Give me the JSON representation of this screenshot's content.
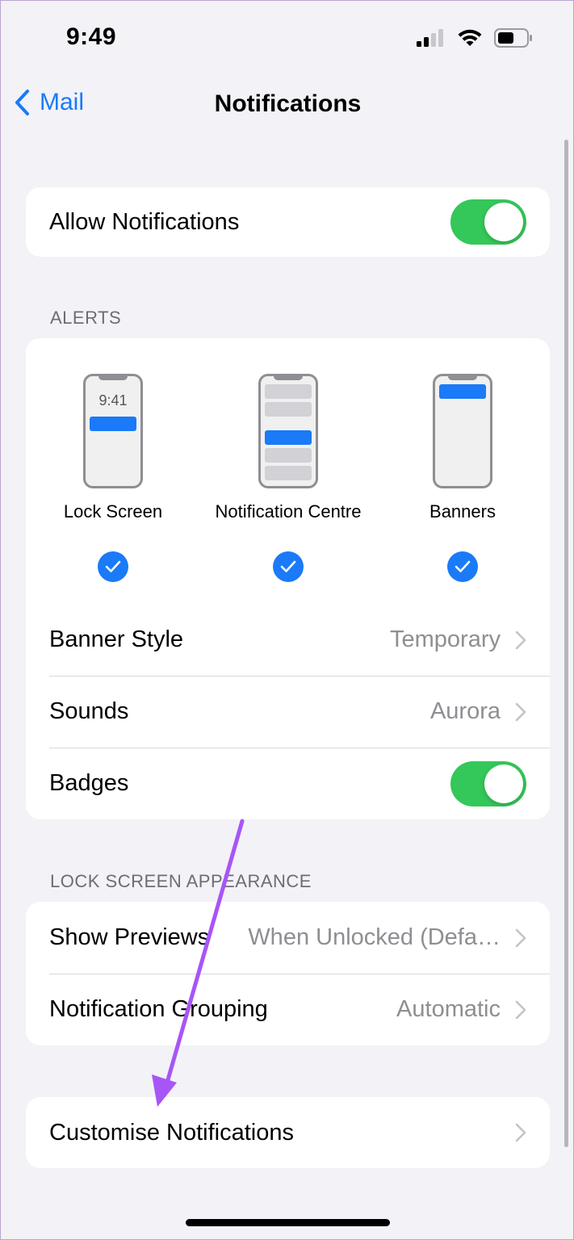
{
  "status_bar": {
    "time": "9:49"
  },
  "nav": {
    "back_label": "Mail",
    "title": "Notifications"
  },
  "allow_notifications": {
    "label": "Allow Notifications",
    "enabled": true
  },
  "alerts": {
    "header": "ALERTS",
    "options": [
      {
        "label": "Lock Screen",
        "preview_time": "9:41",
        "checked": true
      },
      {
        "label": "Notification Centre",
        "checked": true
      },
      {
        "label": "Banners",
        "checked": true
      }
    ],
    "banner_style": {
      "label": "Banner Style",
      "value": "Temporary"
    },
    "sounds": {
      "label": "Sounds",
      "value": "Aurora"
    },
    "badges": {
      "label": "Badges",
      "enabled": true
    }
  },
  "lock_screen_appearance": {
    "header": "LOCK SCREEN APPEARANCE",
    "show_previews": {
      "label": "Show Previews",
      "value": "When Unlocked (Defa…"
    },
    "notification_grouping": {
      "label": "Notification Grouping",
      "value": "Automatic"
    }
  },
  "customise": {
    "label": "Customise Notifications"
  },
  "colors": {
    "accent": "#1a7af8",
    "toggle_on": "#34c759",
    "annotation_arrow": "#a855f7",
    "background": "#f2f2f7"
  }
}
